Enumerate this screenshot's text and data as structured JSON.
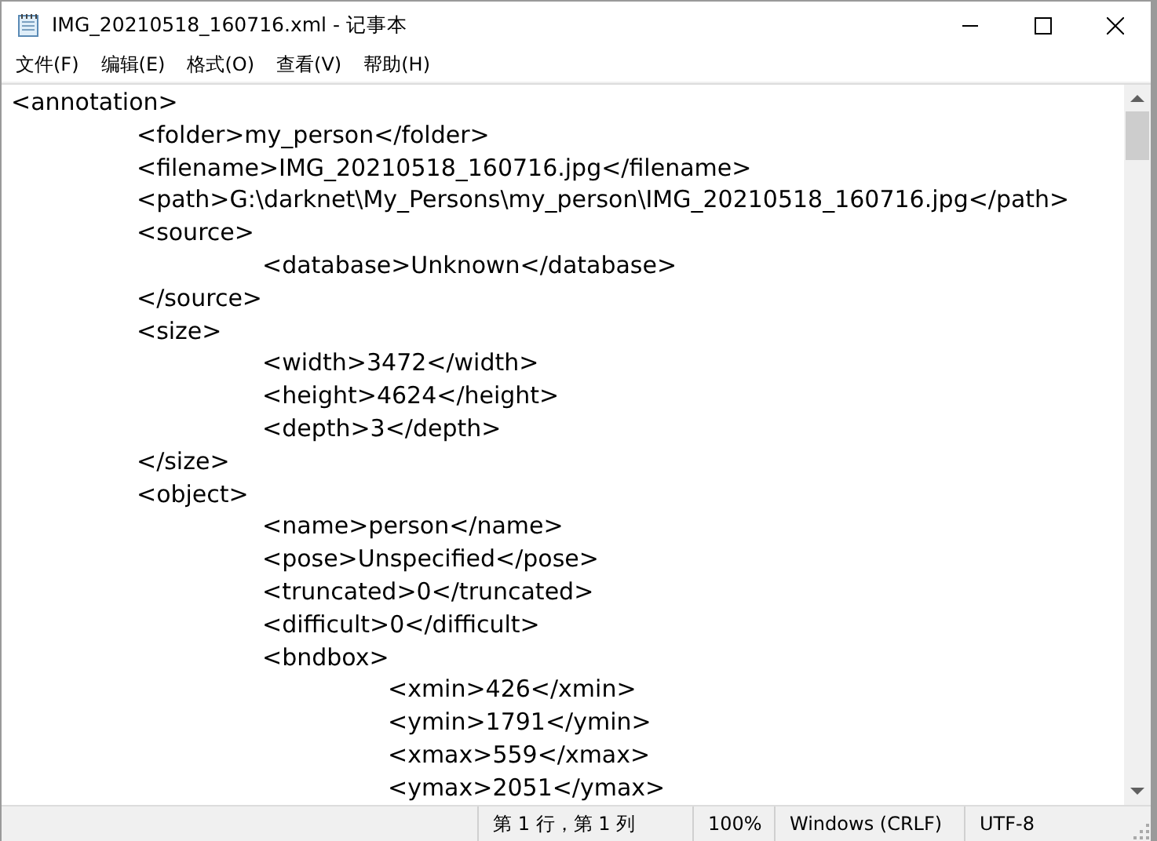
{
  "window": {
    "title": "IMG_20210518_160716.xml - 记事本"
  },
  "menu": [
    "文件(F)",
    "编辑(E)",
    "格式(O)",
    "查看(V)",
    "帮助(H)"
  ],
  "editor": {
    "lines": [
      "<annotation>",
      "\t<folder>my_person</folder>",
      "\t<filename>IMG_20210518_160716.jpg</filename>",
      "\t<path>G:\\darknet\\My_Persons\\my_person\\IMG_20210518_160716.jpg</path>",
      "\t<source>",
      "\t\t<database>Unknown</database>",
      "\t</source>",
      "\t<size>",
      "\t\t<width>3472</width>",
      "\t\t<height>4624</height>",
      "\t\t<depth>3</depth>",
      "\t</size>",
      "\t<object>",
      "\t\t<name>person</name>",
      "\t\t<pose>Unspecified</pose>",
      "\t\t<truncated>0</truncated>",
      "\t\t<difficult>0</difficult>",
      "\t\t<bndbox>",
      "\t\t\t<xmin>426</xmin>",
      "\t\t\t<ymin>1791</ymin>",
      "\t\t\t<xmax>559</xmax>",
      "\t\t\t<ymax>2051</ymax>"
    ]
  },
  "status_bar": [
    "第 1 行，第 1 列",
    "100%",
    "Windows (CRLF)",
    "UTF-8"
  ]
}
